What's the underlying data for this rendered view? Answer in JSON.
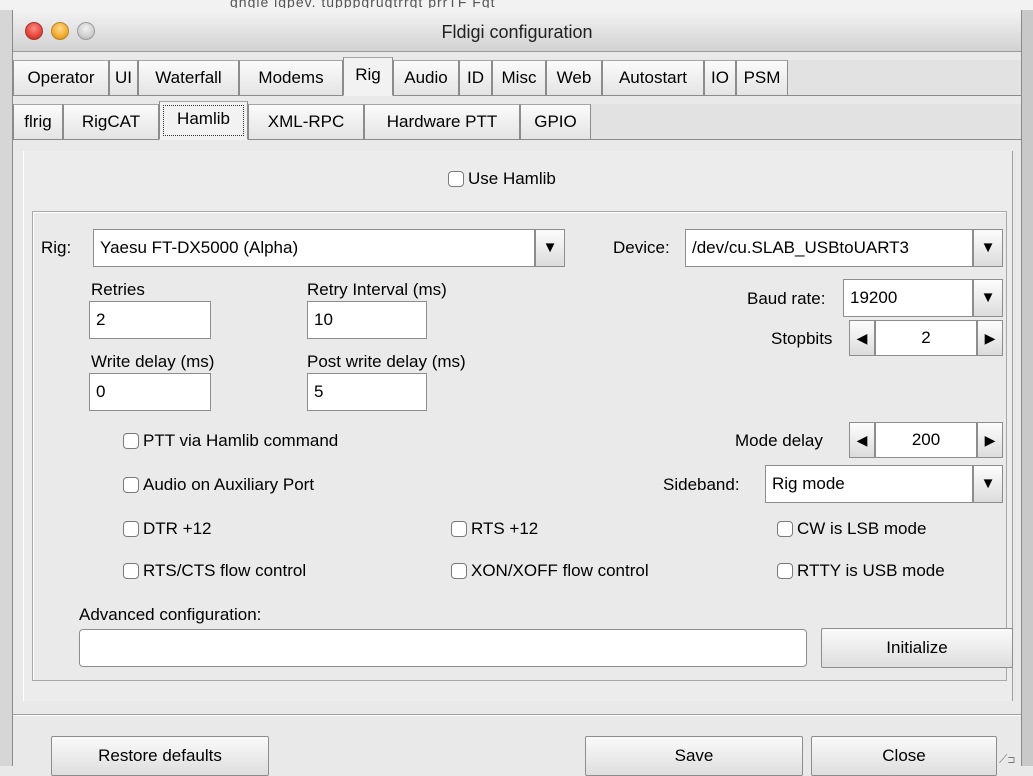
{
  "window": {
    "title": "Fldigi configuration"
  },
  "main_tabs": [
    "Operator",
    "UI",
    "Waterfall",
    "Modems",
    "Rig",
    "Audio",
    "ID",
    "Misc",
    "Web",
    "Autostart",
    "IO",
    "PSM"
  ],
  "sub_tabs": [
    "flrig",
    "RigCAT",
    "Hamlib",
    "XML-RPC",
    "Hardware PTT",
    "GPIO"
  ],
  "active_main_tab": "Rig",
  "active_sub_tab": "Hamlib",
  "hamlib": {
    "use_hamlib_label": "Use Hamlib",
    "use_hamlib_checked": false,
    "rig_label": "Rig:",
    "rig_value": "Yaesu FT-DX5000  (Alpha)",
    "device_label": "Device:",
    "device_value": "/dev/cu.SLAB_USBtoUART3",
    "retries_label": "Retries",
    "retries_value": "2",
    "retry_interval_label": "Retry Interval (ms)",
    "retry_interval_value": "10",
    "baud_label": "Baud rate:",
    "baud_value": "19200",
    "stopbits_label": "Stopbits",
    "stopbits_value": "2",
    "write_delay_label": "Write delay (ms)",
    "write_delay_value": "0",
    "post_write_delay_label": "Post write delay (ms)",
    "post_write_delay_value": "5",
    "ptt_label": "PTT via Hamlib command",
    "mode_delay_label": "Mode delay",
    "mode_delay_value": "200",
    "audio_aux_label": "Audio on Auxiliary Port",
    "sideband_label": "Sideband:",
    "sideband_value": "Rig mode",
    "dtr_label": "DTR +12",
    "rts_label": "RTS +12",
    "cw_lsb_label": "CW is LSB mode",
    "rts_cts_label": "RTS/CTS flow control",
    "xon_xoff_label": "XON/XOFF flow control",
    "rtty_usb_label": "RTTY is USB mode",
    "advanced_label": "Advanced configuration:",
    "advanced_value": "",
    "initialize_label": "Initialize"
  },
  "footer": {
    "restore_label": "Restore defaults",
    "save_label": "Save",
    "close_label": "Close"
  },
  "background": {
    "scribble": "ghgie igpev. tupppgrugtrrgt prrTF Fgt"
  },
  "colors": {
    "close_red": "#e3443a",
    "minimize_yellow": "#f2ac2f",
    "panel_bg": "#ececec"
  }
}
